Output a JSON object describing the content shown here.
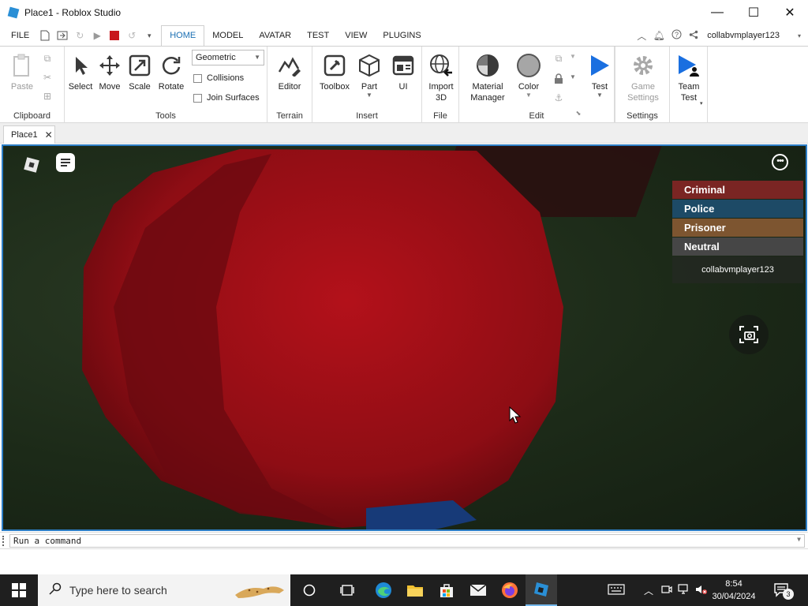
{
  "window": {
    "title": "Place1 - Roblox Studio",
    "minimize": "—",
    "maximize": "☐",
    "close": "✕"
  },
  "menubar": {
    "items": [
      "FILE",
      "HOME",
      "MODEL",
      "AVATAR",
      "TEST",
      "VIEW",
      "PLUGINS"
    ],
    "active": "HOME",
    "username": "collabvmplayer123"
  },
  "ribbon": {
    "clipboard": {
      "label": "Clipboard",
      "paste": "Paste"
    },
    "tools": {
      "label": "Tools",
      "select": "Select",
      "move": "Move",
      "scale": "Scale",
      "rotate": "Rotate",
      "mode": "Geometric",
      "collisions": "Collisions",
      "join_surfaces": "Join Surfaces"
    },
    "terrain": {
      "label": "Terrain",
      "editor": "Editor"
    },
    "insert": {
      "label": "Insert",
      "toolbox": "Toolbox",
      "part": "Part",
      "ui": "UI"
    },
    "file": {
      "label": "File",
      "import3d_line1": "Import",
      "import3d_line2": "3D"
    },
    "edit": {
      "label": "Edit",
      "material_line1": "Material",
      "material_line2": "Manager",
      "color": "Color"
    },
    "test": {
      "test": "Test"
    },
    "settings": {
      "label": "Settings",
      "game_line1": "Game",
      "game_line2": "Settings"
    },
    "team": {
      "line1": "Team",
      "line2": "Test"
    }
  },
  "doc_tab": {
    "label": "Place1",
    "close": "✕"
  },
  "viewport": {
    "teams": [
      {
        "name": "Criminal",
        "color": "#7a2523"
      },
      {
        "name": "Police",
        "color": "#1d4a66"
      },
      {
        "name": "Prisoner",
        "color": "#7d5530"
      },
      {
        "name": "Neutral",
        "color": "#464646"
      }
    ],
    "player": "collabvmplayer123",
    "more_glyph": "•••"
  },
  "command_bar": {
    "placeholder": "Run a command"
  },
  "taskbar": {
    "search_placeholder": "Type here to search",
    "time": "8:54",
    "date": "30/04/2024",
    "notification_count": "3"
  }
}
